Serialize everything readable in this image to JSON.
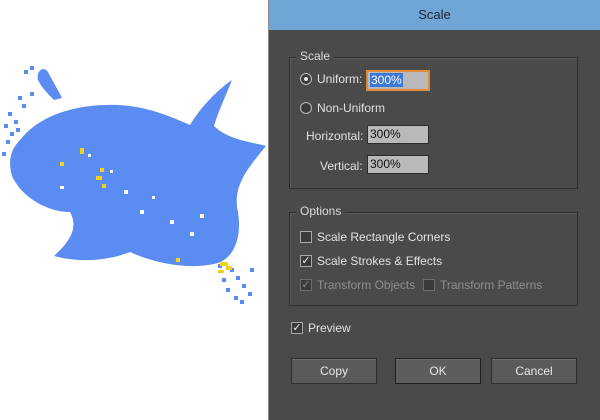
{
  "dialog": {
    "title": "Scale",
    "scale_group": {
      "title": "Scale",
      "uniform": {
        "label": "Uniform:",
        "value": "300%",
        "selected": true
      },
      "non_uniform": {
        "label": "Non-Uniform",
        "selected": false
      },
      "horizontal": {
        "label": "Horizontal:",
        "value": "300%"
      },
      "vertical": {
        "label": "Vertical:",
        "value": "300%"
      }
    },
    "options_group": {
      "title": "Options",
      "scale_rectangle_corners": {
        "label": "Scale Rectangle Corners",
        "checked": false
      },
      "scale_strokes_effects": {
        "label": "Scale Strokes & Effects",
        "checked": true
      },
      "transform_objects": {
        "label": "Transform Objects",
        "checked": true,
        "enabled": false
      },
      "transform_patterns": {
        "label": "Transform Patterns",
        "checked": false,
        "enabled": false
      }
    },
    "preview": {
      "label": "Preview",
      "checked": true
    },
    "buttons": {
      "copy": "Copy",
      "ok": "OK",
      "cancel": "Cancel"
    }
  },
  "colors": {
    "artwork_fill": "#5b8cf2",
    "artwork_highlight": "#f4d11a",
    "dialog_bg": "#4a4a4a",
    "titlebar_bg": "#6fa6d6",
    "selection": "#3b78d8",
    "focus_ring": "#e18a3a"
  },
  "icons": {
    "check": "check-icon",
    "radio": "radio-button-icon"
  }
}
